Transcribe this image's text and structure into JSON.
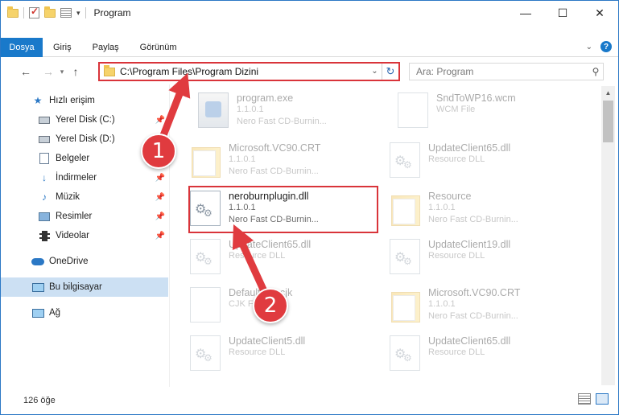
{
  "window": {
    "title": "Program",
    "controls": {
      "minimize": "—",
      "maximize": "☐",
      "close": "✕"
    }
  },
  "ribbon": {
    "tabs": [
      "Dosya",
      "Giriş",
      "Paylaş",
      "Görünüm"
    ],
    "help": "?"
  },
  "nav": {
    "back": "←",
    "forward": "→",
    "up": "↑",
    "address": "C:\\Program Files\\Program Dizini",
    "search_placeholder": "Ara: Program"
  },
  "sidebar": {
    "items": [
      {
        "label": "Hızlı erişim",
        "icon": "star-icon"
      },
      {
        "label": "Yerel Disk (C:)",
        "icon": "drive-icon",
        "pinned": true
      },
      {
        "label": "Yerel Disk (D:)",
        "icon": "drive-icon"
      },
      {
        "label": "Belgeler",
        "icon": "documents-icon"
      },
      {
        "label": "İndirmeler",
        "icon": "downloads-icon",
        "pinned": true
      },
      {
        "label": "Müzik",
        "icon": "music-icon",
        "pinned": true
      },
      {
        "label": "Resimler",
        "icon": "pictures-icon",
        "pinned": true
      },
      {
        "label": "Videolar",
        "icon": "videos-icon",
        "pinned": true
      },
      {
        "label": "OneDrive",
        "icon": "onedrive-icon"
      },
      {
        "label": "Bu bilgisayar",
        "icon": "pc-icon",
        "selected": true
      },
      {
        "label": "Ağ",
        "icon": "network-icon"
      }
    ]
  },
  "files": [
    {
      "name": "program.exe",
      "line1": "1.1.0.1",
      "line2": "Nero Fast CD-Burnin...",
      "icon": "exe-icon"
    },
    {
      "name": "SndToWP16.wcm",
      "line1": "WCM File",
      "line2": "",
      "icon": "file-icon"
    },
    {
      "name": "Microsoft.VC90.CRT",
      "line1": "1.1.0.1",
      "line2": "Nero Fast CD-Burnin...",
      "icon": "folder-icon"
    },
    {
      "name": "UpdateClient65.dll",
      "line1": "Resource DLL",
      "line2": "",
      "icon": "dll-icon"
    },
    {
      "name": "neroburnplugin.dll",
      "line1": "1.1.0.1",
      "line2": "Nero Fast CD-Burnin...",
      "icon": "dll-icon"
    },
    {
      "name": "Resource",
      "line1": "1.1.0.1",
      "line2": "Nero Fast CD-Burnin...",
      "icon": "folder-icon"
    },
    {
      "name": "UpdateClient65.dll",
      "line1": "Resource DLL",
      "line2": "",
      "icon": "dll-icon"
    },
    {
      "name": "UpdateClient19.dll",
      "line1": "Resource DLL",
      "line2": "",
      "icon": "dll-icon"
    },
    {
      "name": "Defaultfont.cjk",
      "line1": "CJK File",
      "line2": "",
      "icon": "file-icon"
    },
    {
      "name": "Microsoft.VC90.CRT",
      "line1": "1.1.0.1",
      "line2": "Nero Fast CD-Burnin...",
      "icon": "folder-icon"
    },
    {
      "name": "UpdateClient5.dll",
      "line1": "Resource DLL",
      "line2": "",
      "icon": "dll-icon"
    },
    {
      "name": "UpdateClient65.dll",
      "line1": "Resource DLL",
      "line2": "",
      "icon": "dll-icon"
    }
  ],
  "status": {
    "count": "126 öğe"
  },
  "annotations": {
    "badge1": "1",
    "badge2": "2",
    "color": "#e03b3f"
  }
}
